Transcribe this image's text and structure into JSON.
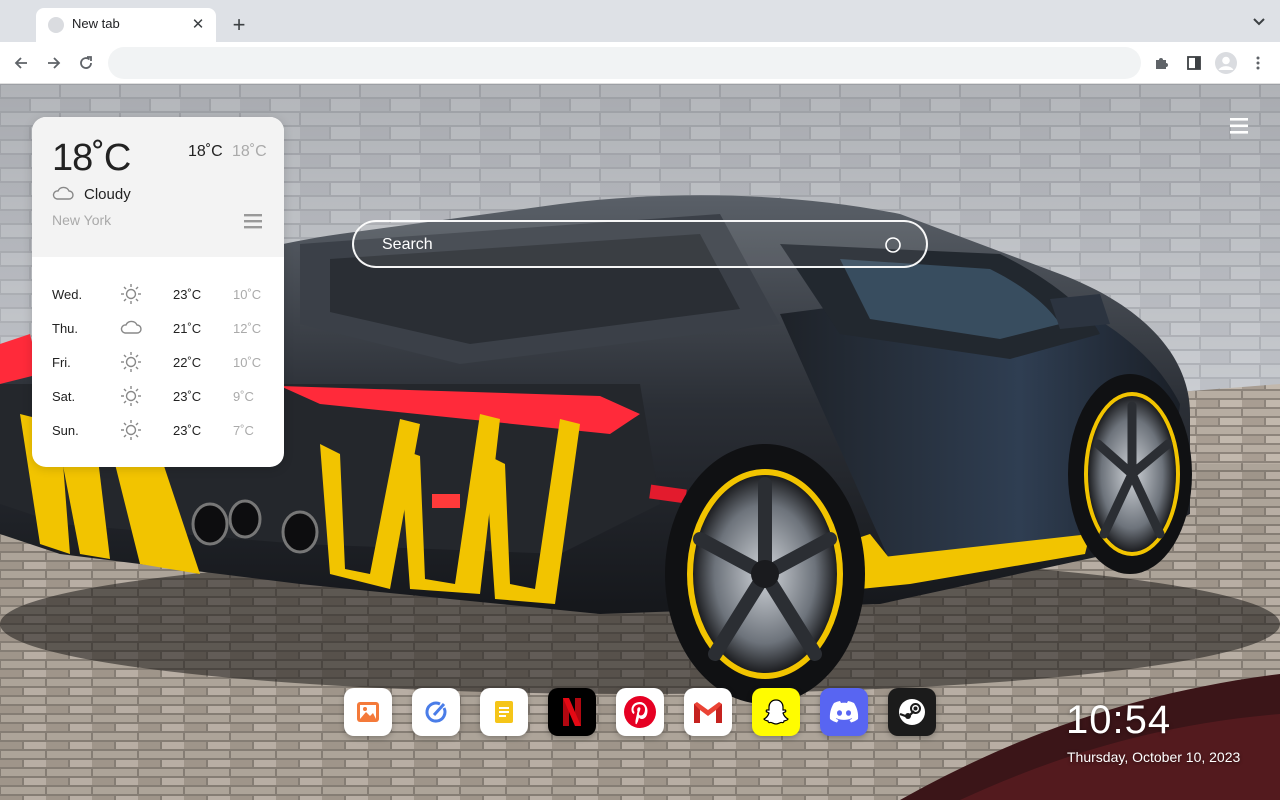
{
  "browser": {
    "tab_title": "New tab",
    "address_value": "",
    "address_placeholder": ""
  },
  "weather": {
    "current_temp": "18˚C",
    "high": "18˚C",
    "low": "18˚C",
    "condition": "Cloudy",
    "city": "New York",
    "forecast": [
      {
        "day": "Wed.",
        "icon": "sun-icon",
        "high": "23˚C",
        "low": "10˚C"
      },
      {
        "day": "Thu.",
        "icon": "cloud-icon",
        "high": "21˚C",
        "low": "12˚C"
      },
      {
        "day": "Fri.",
        "icon": "sun-icon",
        "high": "22˚C",
        "low": "10˚C"
      },
      {
        "day": "Sat.",
        "icon": "sun-icon",
        "high": "23˚C",
        "low": "9˚C"
      },
      {
        "day": "Sun.",
        "icon": "sun-icon",
        "high": "23˚C",
        "low": "7˚C"
      }
    ]
  },
  "search": {
    "placeholder": "Search"
  },
  "dock": {
    "apps": [
      {
        "name": "photos-app",
        "icon": "image-icon",
        "bg": "#ffffff"
      },
      {
        "name": "edit-app",
        "icon": "pen-circle-icon",
        "bg": "#ffffff"
      },
      {
        "name": "notes-app",
        "icon": "note-icon",
        "bg": "#ffffff"
      },
      {
        "name": "netflix-app",
        "icon": "netflix-icon",
        "bg": "#000000"
      },
      {
        "name": "pinterest-app",
        "icon": "pinterest-icon",
        "bg": "#ffffff"
      },
      {
        "name": "gmail-app",
        "icon": "gmail-icon",
        "bg": "#ffffff"
      },
      {
        "name": "snapchat-app",
        "icon": "snapchat-icon",
        "bg": "#fffc00"
      },
      {
        "name": "discord-app",
        "icon": "discord-icon",
        "bg": "#5865f2"
      },
      {
        "name": "steam-app",
        "icon": "steam-icon",
        "bg": "#1b1b1b"
      }
    ]
  },
  "clock": {
    "time": "10:54",
    "date": "Thursday, October 10, 2023"
  },
  "colors": {
    "accent_yellow": "#f2c400",
    "car_body": "#2a2d33",
    "taillight": "#ff2a3a"
  }
}
